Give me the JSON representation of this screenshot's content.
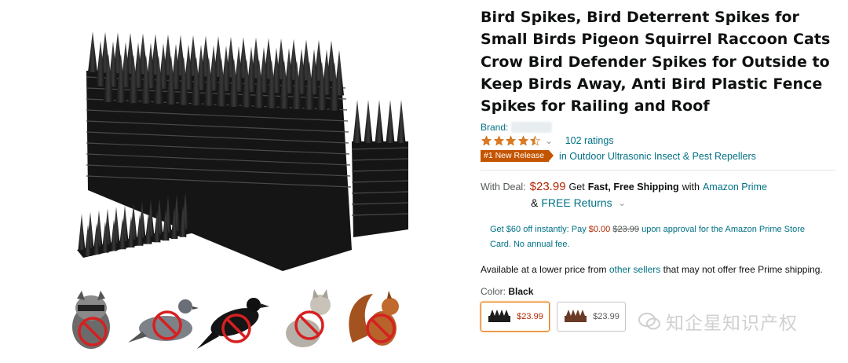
{
  "product": {
    "title": "Bird Spikes, Bird Deterrent Spikes for Small Birds Pigeon Squirrel Raccoon Cats Crow Bird Defender Spikes for Outside to Keep Birds Away, Anti Bird Plastic Fence Spikes for Railing and Roof",
    "brand_label": "Brand:",
    "rating_stars": 4,
    "ratings_count": "102 ratings",
    "badge": "#1 New Release",
    "category": "in Outdoor Ultrasonic Insect & Pest Repellers"
  },
  "deal": {
    "label": "With Deal:",
    "price": "$23.99",
    "ship_prefix": "Get",
    "ship_bold": "Fast, Free Shipping",
    "ship_with": "with",
    "prime": "Amazon Prime",
    "amp": "&",
    "free_returns": "FREE Returns"
  },
  "promo": {
    "prefix": "Get $60 off instantly: Pay",
    "pay": "$0.00",
    "was": "$23.99",
    "suffix": "upon approval for the Amazon Prime Store Card. No annual fee."
  },
  "availability": {
    "prefix": "Available at a lower price from",
    "link": "other sellers",
    "suffix": "that may not offer free Prime shipping."
  },
  "color": {
    "label": "Color:",
    "value": "Black",
    "options": [
      {
        "name": "Black",
        "price": "$23.99",
        "color": "#1c1c1c"
      },
      {
        "name": "Brown",
        "price": "$23.99",
        "color": "#6b3a26"
      }
    ]
  },
  "animals": [
    "raccoon-icon",
    "pigeon-icon",
    "crow-icon",
    "cat-icon",
    "squirrel-icon"
  ],
  "watermark": "知企星知识产权",
  "colors": {
    "link": "#007185",
    "price": "#b12704",
    "badge": "#c45500",
    "star": "#de7921"
  }
}
